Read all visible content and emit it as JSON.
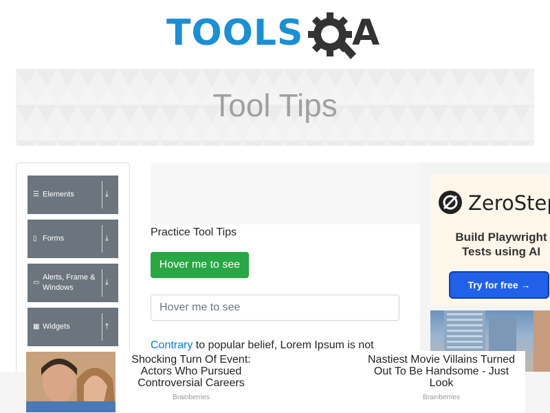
{
  "logo": {
    "text": "TOOLS",
    "letter_a": "A",
    "brand_color": "#1b8fd6"
  },
  "banner": {
    "title": "Tool Tips"
  },
  "sidebar": {
    "items": [
      {
        "label": "Elements",
        "icon": "menu-icon",
        "arrow": "download-arrow-icon"
      },
      {
        "label": "Forms",
        "icon": "form-icon",
        "arrow": "download-arrow-icon"
      },
      {
        "label": "Alerts, Frame & Windows",
        "icon": "window-icon",
        "arrow": "download-arrow-icon"
      },
      {
        "label": "Widgets",
        "icon": "grid-icon",
        "arrow": "upload-arrow-icon"
      }
    ]
  },
  "main": {
    "heading": "Practice Tool Tips",
    "hover_button_label": "Hover me to see",
    "hover_field_placeholder": "Hover me to see",
    "paragraph_link": "Contrary",
    "paragraph_text": " to popular belief, Lorem Ipsum is not"
  },
  "right_ad": {
    "brand": "ZeroStep",
    "headline": "Build Playwright Tests using AI",
    "cta": "Try for free →",
    "cta_color": "#2160e9"
  },
  "bottom_ad": {
    "left_title": "Shocking Turn Of Event: Actors Who Pursued Controversial Careers",
    "left_source": "Brainberries",
    "right_title": "Nastiest Movie Villains Turned Out To Be Handsome - Just Look",
    "right_source": "Brainberries"
  }
}
